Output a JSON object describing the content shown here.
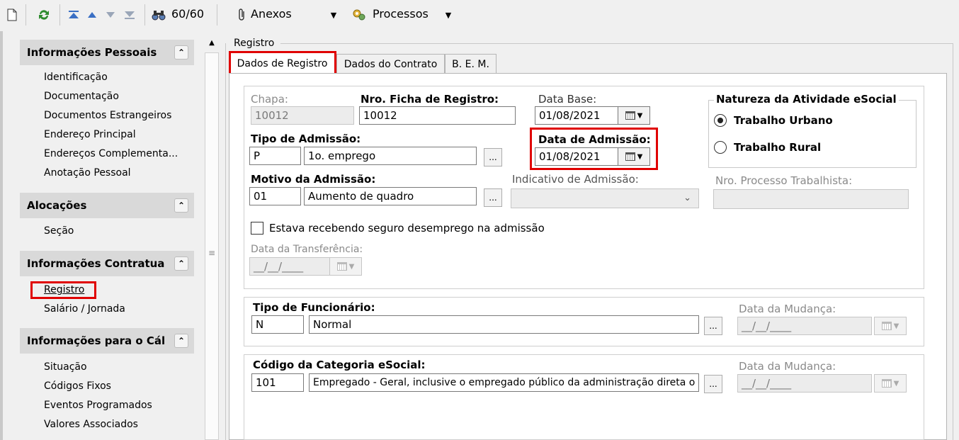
{
  "toolbar": {
    "record_counter": "60/60",
    "attachments_label": "Anexos",
    "processes_label": "Processos"
  },
  "sidebar": {
    "sections": [
      {
        "title": "Informações Pessoais",
        "items": [
          "Identificação",
          "Documentação",
          "Documentos Estrangeiros",
          "Endereço Principal",
          "Endereços Complementa...",
          "Anotação Pessoal"
        ]
      },
      {
        "title": "Alocações",
        "items": [
          "Seção"
        ]
      },
      {
        "title": "Informações Contratua",
        "items": [
          "Registro",
          "Salário / Jornada"
        ]
      },
      {
        "title": "Informações para o Cál",
        "items": [
          "Situação",
          "Códigos Fixos",
          "Eventos Programados",
          "Valores Associados"
        ]
      }
    ]
  },
  "main": {
    "group_title": "Registro",
    "tabs": [
      "Dados de Registro",
      "Dados do Contrato",
      "B. E. M."
    ],
    "active_tab": "Dados de Registro",
    "chapa": {
      "label": "Chapa:",
      "value": "10012"
    },
    "ficha": {
      "label": "Nro. Ficha de Registro:",
      "value": "10012"
    },
    "data_base": {
      "label": "Data Base:",
      "value": "01/08/2021"
    },
    "tipo_admissao": {
      "label": "Tipo de Admissão:",
      "code": "P",
      "desc": "1o. emprego"
    },
    "data_admissao": {
      "label": "Data de Admissão:",
      "value": "01/08/2021"
    },
    "motivo_admissao": {
      "label": "Motivo da Admissão:",
      "code": "01",
      "desc": "Aumento de quadro"
    },
    "indicativo_admissao": {
      "label": "Indicativo de Admissão:",
      "value": ""
    },
    "nro_processo": {
      "label": "Nro. Processo Trabalhista:",
      "value": ""
    },
    "natureza": {
      "title": "Natureza da Atividade eSocial",
      "options": [
        "Trabalho Urbano",
        "Trabalho Rural"
      ],
      "selected": "Trabalho Urbano"
    },
    "seguro_desemprego": {
      "label": "Estava recebendo seguro desemprego na admissão",
      "checked": false
    },
    "data_transferencia": {
      "label": "Data da Transferência:",
      "value": "__/__/____"
    },
    "tipo_funcionario": {
      "label": "Tipo de Funcionário:",
      "code": "N",
      "desc": "Normal",
      "data_mudanca_label": "Data da Mudança:",
      "data_mudanca": "__/__/____"
    },
    "categoria_esocial": {
      "label": "Código da Categoria eSocial:",
      "code": "101",
      "desc": "Empregado - Geral, inclusive o empregado público da administração direta o",
      "data_mudanca_label": "Data da Mudança:",
      "data_mudanca": "__/__/____"
    },
    "dots_label": "..."
  },
  "colors": {
    "highlight": "#e00000",
    "section_header": "#d9d9d9"
  }
}
